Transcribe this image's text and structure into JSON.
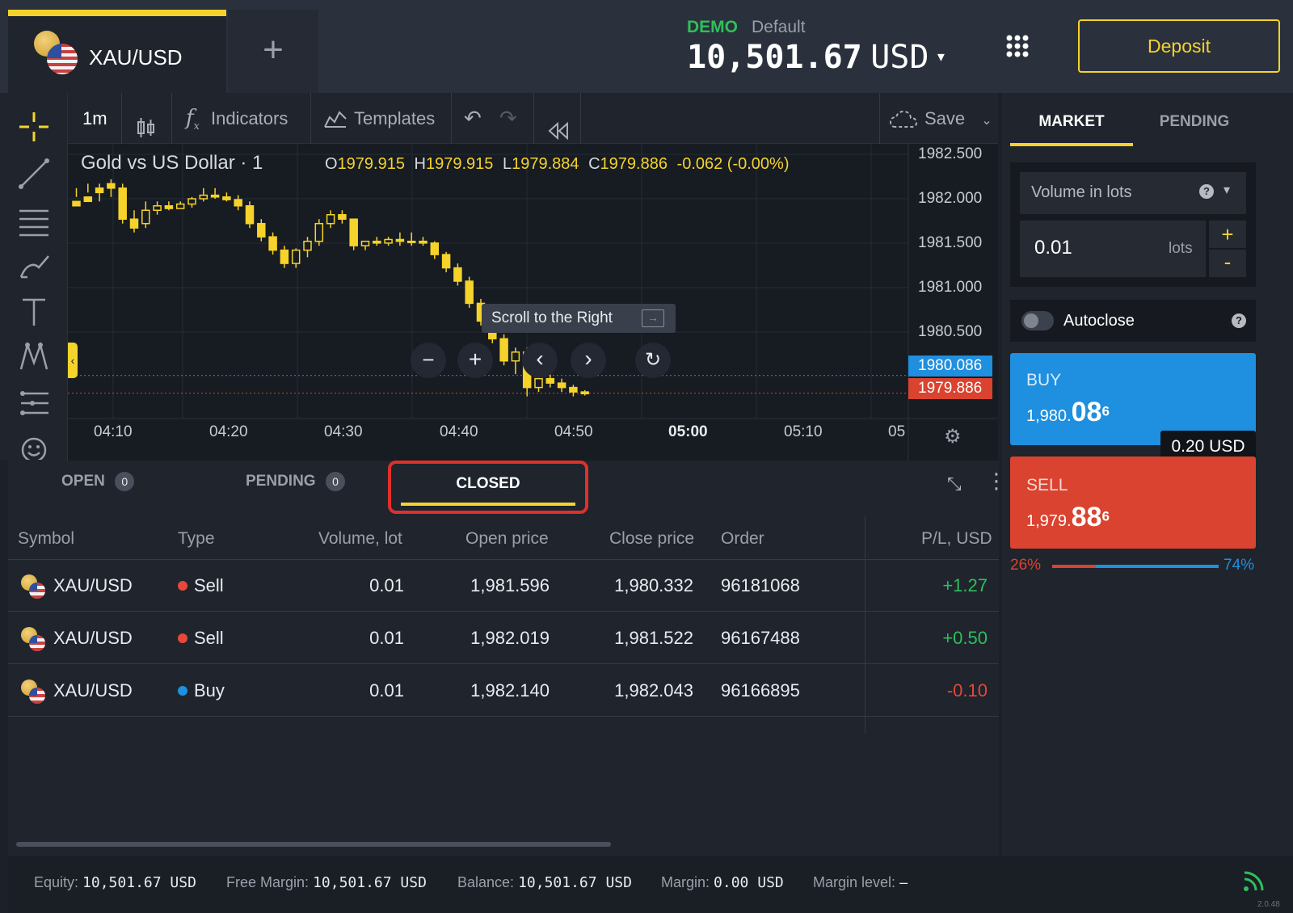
{
  "header": {
    "symbol_tab": "XAU/USD",
    "add_tab": "+",
    "account_mode": "DEMO",
    "account_name": "Default",
    "balance": "10,501.67",
    "currency": "USD",
    "deposit_label": "Deposit"
  },
  "toolbar": {
    "timeframe": "1m",
    "indicators": "Indicators",
    "templates": "Templates",
    "save": "Save"
  },
  "chart": {
    "title": "Gold vs US Dollar · 1",
    "ohlc": {
      "o_label": "O",
      "o": "1979.915",
      "h_label": "H",
      "h": "1979.915",
      "l_label": "L",
      "l": "1979.884",
      "c_label": "C",
      "c": "1979.886",
      "change": "-0.062 (-0.00%)"
    },
    "price_ticks": [
      "1982.500",
      "1982.000",
      "1981.500",
      "1981.000",
      "1980.500"
    ],
    "time_ticks": [
      "04:10",
      "04:20",
      "04:30",
      "04:40",
      "04:50",
      "05:00",
      "05:10",
      "05"
    ],
    "ask_label": "1980.086",
    "bid_label": "1979.886",
    "tooltip": "Scroll to the Right",
    "colors": {
      "candle": "#f5d32a",
      "ask": "#1f8fe0",
      "bid": "#d9432f"
    }
  },
  "chart_data": {
    "type": "candlestick",
    "ylim": [
      1979.6,
      1982.7
    ],
    "candles": [
      [
        1982.05,
        1982.2,
        1982.1,
        1982.0
      ],
      [
        1982.1,
        1982.25,
        1982.15,
        1982.05
      ],
      [
        1982.2,
        1982.25,
        1982.05,
        1982.15
      ],
      [
        1982.25,
        1982.3,
        1982.1,
        1982.2
      ],
      [
        1982.2,
        1982.25,
        1981.8,
        1981.85
      ],
      [
        1981.85,
        1981.95,
        1981.7,
        1981.75
      ],
      [
        1981.8,
        1982.05,
        1981.75,
        1981.95
      ],
      [
        1981.95,
        1982.05,
        1981.9,
        1982.0
      ],
      [
        1982.0,
        1982.05,
        1981.95,
        1981.97
      ],
      [
        1981.97,
        1982.05,
        1981.97,
        1982.02
      ],
      [
        1982.02,
        1982.1,
        1981.98,
        1982.08
      ],
      [
        1982.08,
        1982.2,
        1982.05,
        1982.12
      ],
      [
        1982.12,
        1982.2,
        1982.08,
        1982.1
      ],
      [
        1982.1,
        1982.15,
        1982.05,
        1982.07
      ],
      [
        1982.07,
        1982.12,
        1981.95,
        1982.0
      ],
      [
        1982.0,
        1982.05,
        1981.75,
        1981.8
      ],
      [
        1981.8,
        1981.85,
        1981.6,
        1981.65
      ],
      [
        1981.65,
        1981.7,
        1981.45,
        1981.5
      ],
      [
        1981.5,
        1981.55,
        1981.3,
        1981.35
      ],
      [
        1981.35,
        1981.52,
        1981.3,
        1981.5
      ],
      [
        1981.5,
        1981.65,
        1981.42,
        1981.6
      ],
      [
        1981.6,
        1981.85,
        1981.55,
        1981.8
      ],
      [
        1981.8,
        1981.95,
        1981.75,
        1981.9
      ],
      [
        1981.9,
        1981.95,
        1981.8,
        1981.85
      ],
      [
        1981.85,
        1981.85,
        1981.5,
        1981.55
      ],
      [
        1981.55,
        1981.6,
        1981.5,
        1981.6
      ],
      [
        1981.6,
        1981.65,
        1981.55,
        1981.58
      ],
      [
        1981.58,
        1981.65,
        1981.55,
        1981.62
      ],
      [
        1981.62,
        1981.7,
        1981.55,
        1981.6
      ],
      [
        1981.6,
        1981.7,
        1981.55,
        1981.6
      ],
      [
        1981.6,
        1981.65,
        1981.55,
        1981.58
      ],
      [
        1981.58,
        1981.6,
        1981.4,
        1981.45
      ],
      [
        1981.45,
        1981.48,
        1981.25,
        1981.3
      ],
      [
        1981.3,
        1981.35,
        1981.1,
        1981.15
      ],
      [
        1981.15,
        1981.2,
        1980.85,
        1980.9
      ],
      [
        1980.9,
        1980.95,
        1980.65,
        1980.7
      ],
      [
        1980.7,
        1980.75,
        1980.45,
        1980.5
      ],
      [
        1980.5,
        1980.55,
        1980.2,
        1980.25
      ],
      [
        1980.25,
        1980.4,
        1980.1,
        1980.35
      ],
      [
        1980.35,
        1980.4,
        1979.85,
        1979.95
      ],
      [
        1979.95,
        1980.1,
        1979.9,
        1980.05
      ],
      [
        1980.05,
        1980.12,
        1979.95,
        1980.0
      ],
      [
        1980.0,
        1980.05,
        1979.9,
        1979.95
      ],
      [
        1979.95,
        1979.98,
        1979.85,
        1979.9
      ],
      [
        1979.9,
        1979.92,
        1979.86,
        1979.88
      ]
    ]
  },
  "chart_controls": {
    "zoom_out": "−",
    "zoom_in": "+"
  },
  "trade_panel": {
    "tab_market": "MARKET",
    "tab_pending": "PENDING",
    "volume_select": "Volume in lots",
    "volume_value": "0.01",
    "volume_unit": "lots",
    "plus": "+",
    "minus": "-",
    "autoclose": "Autoclose",
    "buy_label": "BUY",
    "buy_price_small": "1,980.",
    "buy_price_big": "08",
    "buy_price_sup": "6",
    "sell_label": "SELL",
    "sell_price_small": "1,979.",
    "sell_price_big": "88",
    "sell_price_sup": "6",
    "spread": "0.20 USD",
    "sentiment_sell": "26%",
    "sentiment_buy": "74%",
    "sentiment_sell_fraction": 0.26
  },
  "positions": {
    "tabs": [
      {
        "label": "OPEN",
        "count": "0"
      },
      {
        "label": "PENDING",
        "count": "0"
      },
      {
        "label": "CLOSED"
      }
    ],
    "headers": [
      "Symbol",
      "Type",
      "Volume, lot",
      "Open price",
      "Close price",
      "Order",
      "P/L, USD"
    ],
    "rows": [
      {
        "symbol": "XAU/USD",
        "type": "Sell",
        "volume": "0.01",
        "open": "1,981.596",
        "close": "1,980.332",
        "order": "96181068",
        "pl": "+1.27"
      },
      {
        "symbol": "XAU/USD",
        "type": "Sell",
        "volume": "0.01",
        "open": "1,982.019",
        "close": "1,981.522",
        "order": "96167488",
        "pl": "+0.50"
      },
      {
        "symbol": "XAU/USD",
        "type": "Buy",
        "volume": "0.01",
        "open": "1,982.140",
        "close": "1,982.043",
        "order": "96166895",
        "pl": "-0.10"
      }
    ]
  },
  "status": {
    "equity_label": "Equity:",
    "equity": "10,501.67 USD",
    "free_margin_label": "Free Margin:",
    "free_margin": "10,501.67 USD",
    "balance_label": "Balance:",
    "balance": "10,501.67 USD",
    "margin_label": "Margin:",
    "margin": "0.00 USD",
    "margin_level_label": "Margin level:",
    "margin_level": "–",
    "version": "2.0.48"
  }
}
